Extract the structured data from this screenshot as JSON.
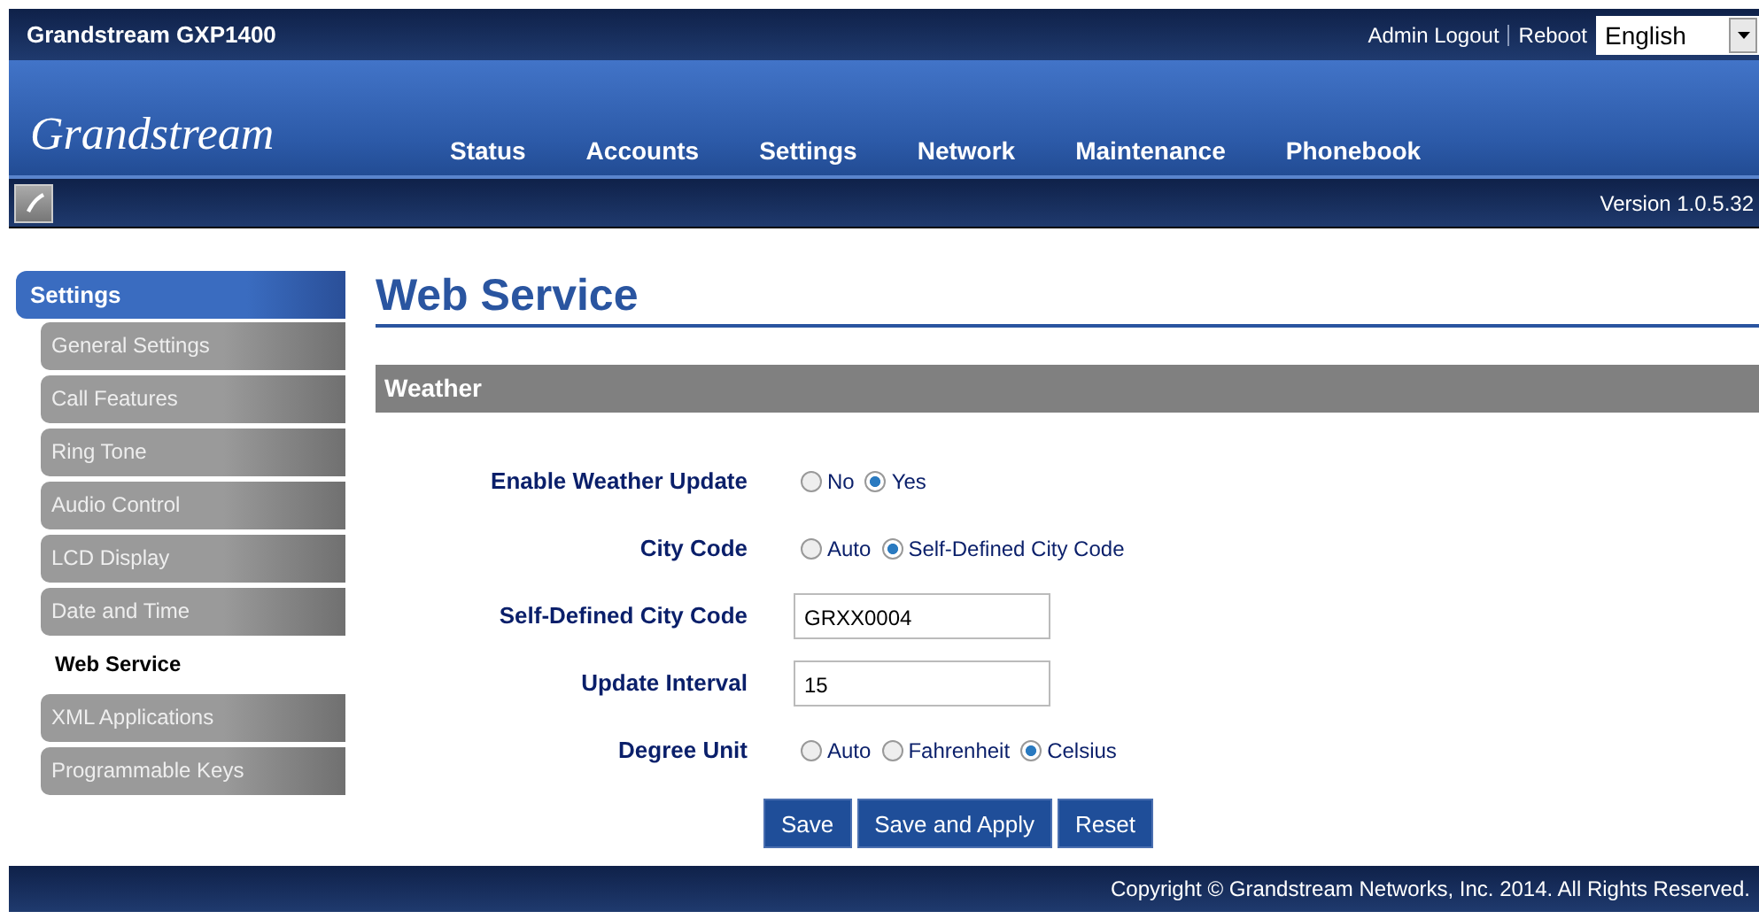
{
  "header": {
    "product": "Grandstream GXP1400",
    "links": [
      "Admin Logout",
      "Reboot"
    ],
    "language": "English",
    "logo": "Grandstream",
    "version": "Version 1.0.5.32"
  },
  "nav": [
    {
      "label": "Status",
      "selected": false
    },
    {
      "label": "Accounts",
      "selected": false
    },
    {
      "label": "Settings",
      "selected": false
    },
    {
      "label": "Network",
      "selected": false
    },
    {
      "label": "Maintenance",
      "selected": false
    },
    {
      "label": "Phonebook",
      "selected": false
    }
  ],
  "sidebar": {
    "title": "Settings",
    "items": [
      {
        "label": "General Settings",
        "selected": false
      },
      {
        "label": "Call Features",
        "selected": false
      },
      {
        "label": "Ring Tone",
        "selected": false
      },
      {
        "label": "Audio Control",
        "selected": false
      },
      {
        "label": "LCD Display",
        "selected": false
      },
      {
        "label": "Date and Time",
        "selected": false
      },
      {
        "label": "Web Service",
        "selected": true
      },
      {
        "label": "XML Applications",
        "selected": false
      },
      {
        "label": "Programmable Keys",
        "selected": false
      }
    ]
  },
  "page": {
    "title": "Web Service",
    "section": "Weather",
    "fields": [
      {
        "label": "Enable Weather Update",
        "kind": "radio",
        "options": [
          {
            "label": "No",
            "selected": false
          },
          {
            "label": "Yes",
            "selected": true
          }
        ]
      },
      {
        "label": "City Code",
        "kind": "radio",
        "options": [
          {
            "label": "Auto",
            "selected": false
          },
          {
            "label": "Self-Defined City Code",
            "selected": true
          }
        ]
      },
      {
        "label": "Self-Defined City Code",
        "kind": "text",
        "value": "GRXX0004"
      },
      {
        "label": "Update Interval",
        "kind": "text",
        "value": "15"
      },
      {
        "label": "Degree Unit",
        "kind": "radio",
        "options": [
          {
            "label": "Auto",
            "selected": false
          },
          {
            "label": "Fahrenheit",
            "selected": false
          },
          {
            "label": "Celsius",
            "selected": true
          }
        ]
      }
    ],
    "buttons": [
      "Save",
      "Save and Apply",
      "Reset"
    ]
  },
  "footer": "Copyright © Grandstream Networks, Inc. 2014. All Rights Reserved."
}
